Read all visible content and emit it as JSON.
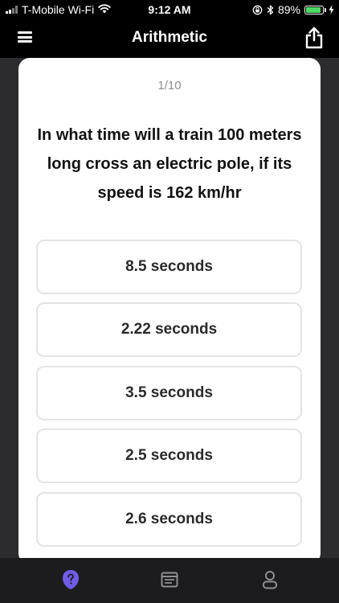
{
  "status_bar": {
    "carrier": "T-Mobile Wi-Fi",
    "time": "9:12 AM",
    "battery_percent": "89%",
    "battery_level": 0.89,
    "icons": [
      "signal-icon",
      "wifi-icon",
      "lock-rotation-icon",
      "bluetooth-icon",
      "battery-icon",
      "charging-icon"
    ]
  },
  "nav": {
    "title": "Arithmetic",
    "menu_icon": "hamburger-menu-icon",
    "share_icon": "share-icon"
  },
  "quiz": {
    "progress": "1/10",
    "question": "In what time will a train 100 meters long cross an electric pole, if its speed is 162 km/hr",
    "options": [
      "8.5 seconds",
      "2.22 seconds",
      "3.5 seconds",
      "2.5 seconds",
      "2.6 seconds"
    ]
  },
  "tab_bar": {
    "tabs": [
      {
        "icon": "question-mark-icon",
        "active": true
      },
      {
        "icon": "notes-icon",
        "active": false
      },
      {
        "icon": "profile-icon",
        "active": false
      }
    ]
  },
  "colors": {
    "accent": "#6e5ce6",
    "tab_inactive": "#8e8e93",
    "background": "#000000",
    "card": "#ffffff",
    "battery": "#4cd964"
  }
}
